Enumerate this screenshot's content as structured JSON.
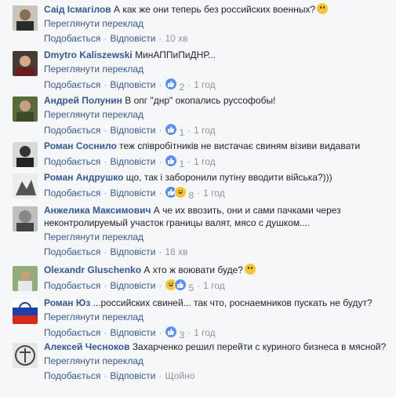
{
  "comments": [
    {
      "author": "Саід Ісмагілов",
      "text": "А как же они теперь без российских военных?",
      "has_emoji": true,
      "translate": "Переглянути переклад",
      "like": "Подобається",
      "reply": "Відповісти",
      "reactions": "",
      "time": "10 хв",
      "reaction_icons": []
    },
    {
      "author": "Dmytro Kaliszewski",
      "text": "МинАППиПиДНР...",
      "has_emoji": false,
      "translate": "Переглянути переклад",
      "like": "Подобається",
      "reply": "Відповісти",
      "reactions": "2",
      "time": "1 год",
      "reaction_icons": [
        "like-icon"
      ]
    },
    {
      "author": "Андрей Полунин",
      "text": "В опг \"днр\" окопались руссофобы!",
      "has_emoji": false,
      "translate": "Переглянути переклад",
      "like": "Подобається",
      "reply": "Відповісти",
      "reactions": "1",
      "time": "1 год",
      "reaction_icons": [
        "like-icon"
      ]
    },
    {
      "author": "Роман Соснило",
      "text": "теж співробітників не вистачає свиням візиви видавати",
      "has_emoji": false,
      "translate": "",
      "like": "Подобається",
      "reply": "Відповісти",
      "reactions": "1",
      "time": "1 год",
      "reaction_icons": [
        "like-icon"
      ]
    },
    {
      "author": "Роман Андрушко",
      "text": "що, так і заборонили путіну вводити війська?)))",
      "has_emoji": false,
      "translate": "",
      "like": "Подобається",
      "reply": "Відповісти",
      "reactions": "8",
      "time": "1 год",
      "reaction_icons": [
        "like-icon",
        "haha-icon"
      ]
    },
    {
      "author": "Анжелика Максимович",
      "text": "А че их ввозить, они и сами пачками через неконтролируемый участок границы валят, мясо с душком....",
      "has_emoji": false,
      "translate": "Переглянути переклад",
      "like": "Подобається",
      "reply": "Відповісти",
      "reactions": "",
      "time": "18 хв",
      "reaction_icons": []
    },
    {
      "author": "Olexandr Gluschenko",
      "text": "А хто ж воювати буде?",
      "has_emoji": true,
      "translate": "",
      "like": "Подобається",
      "reply": "Відповісти",
      "reactions": "5",
      "time": "1 год",
      "reaction_icons": [
        "haha-icon",
        "like-icon"
      ]
    },
    {
      "author": "Роман Юз",
      "text": "...российских свиней... так что, роснаемников пускать не будут?",
      "has_emoji": false,
      "translate": "Переглянути переклад",
      "like": "Подобається",
      "reply": "Відповісти",
      "reactions": "3",
      "time": "1 год",
      "reaction_icons": [
        "like-icon"
      ]
    },
    {
      "author": "Алексей Чесноков",
      "text": "Захарченко решил перейти с куриного бизнеса в мясной?",
      "has_emoji": false,
      "translate": "Переглянути переклад",
      "like": "Подобається",
      "reply": "Відповісти",
      "reactions": "",
      "time": "Щойно",
      "reaction_icons": []
    }
  ],
  "colors": {
    "author": "#365899",
    "link": "#385898",
    "meta": "#90949c",
    "background": "#f6f7f9"
  }
}
